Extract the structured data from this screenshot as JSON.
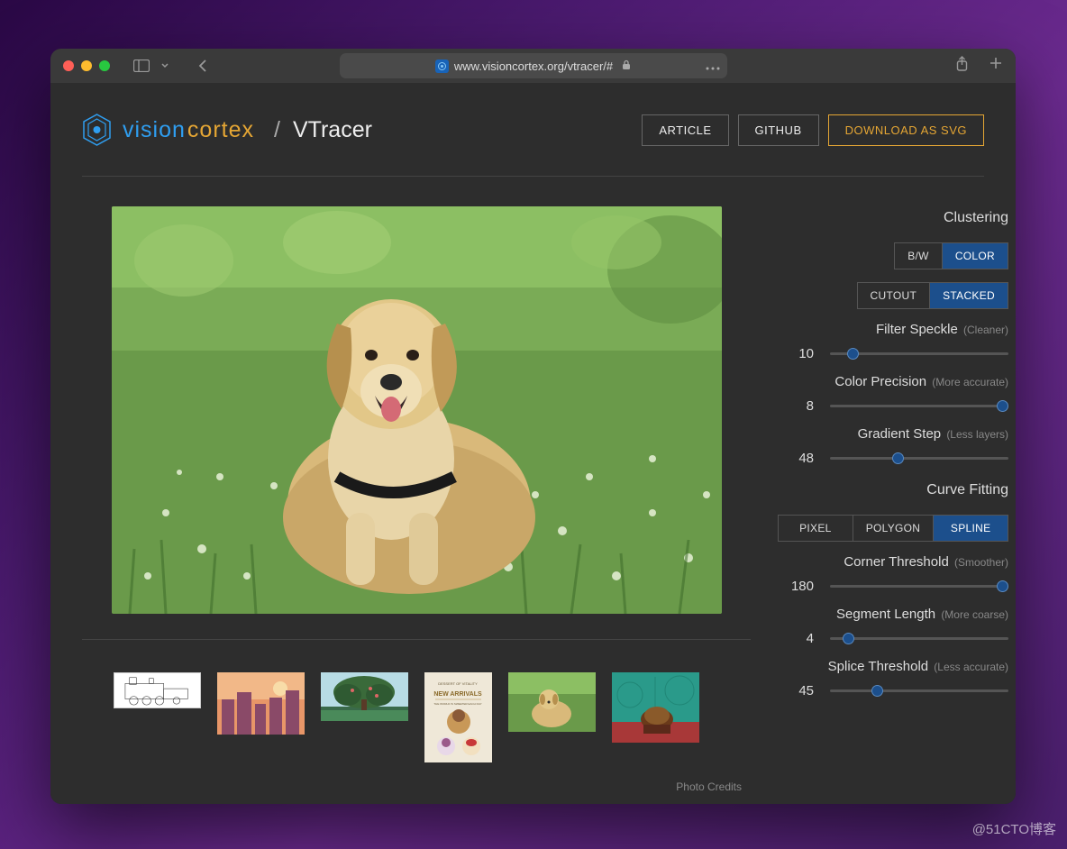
{
  "browser": {
    "url": "www.visioncortex.org/vtracer/#"
  },
  "brand": {
    "vision": "vision",
    "cortex": "cortex",
    "slash": "/",
    "page": "VTracer"
  },
  "nav": {
    "article": "ARTICLE",
    "github": "GITHUB",
    "download": "DOWNLOAD AS SVG"
  },
  "sections": {
    "clustering": "Clustering",
    "curve": "Curve Fitting"
  },
  "toggles": {
    "bw": "B/W",
    "color": "COLOR",
    "cutout": "CUTOUT",
    "stacked": "STACKED",
    "pixel": "PIXEL",
    "polygon": "POLYGON",
    "spline": "SPLINE"
  },
  "sliders": {
    "filter_speckle": {
      "label": "Filter Speckle",
      "hint": "(Cleaner)",
      "value": "10",
      "min": 0,
      "max": 100,
      "pos": 10
    },
    "color_precision": {
      "label": "Color Precision",
      "hint": "(More accurate)",
      "value": "8",
      "min": 1,
      "max": 8,
      "pos": 8
    },
    "gradient_step": {
      "label": "Gradient Step",
      "hint": "(Less layers)",
      "value": "48",
      "min": 0,
      "max": 128,
      "pos": 48
    },
    "corner_threshold": {
      "label": "Corner Threshold",
      "hint": "(Smoother)",
      "value": "180",
      "min": 0,
      "max": 180,
      "pos": 180
    },
    "segment_length": {
      "label": "Segment Length",
      "hint": "(More coarse)",
      "value": "4",
      "min": 1,
      "max": 40,
      "pos": 4
    },
    "splice_threshold": {
      "label": "Splice Threshold",
      "hint": "(Less accurate)",
      "value": "45",
      "min": 0,
      "max": 180,
      "pos": 45
    }
  },
  "credits": "Photo Credits",
  "watermark": "@51CTO博客"
}
